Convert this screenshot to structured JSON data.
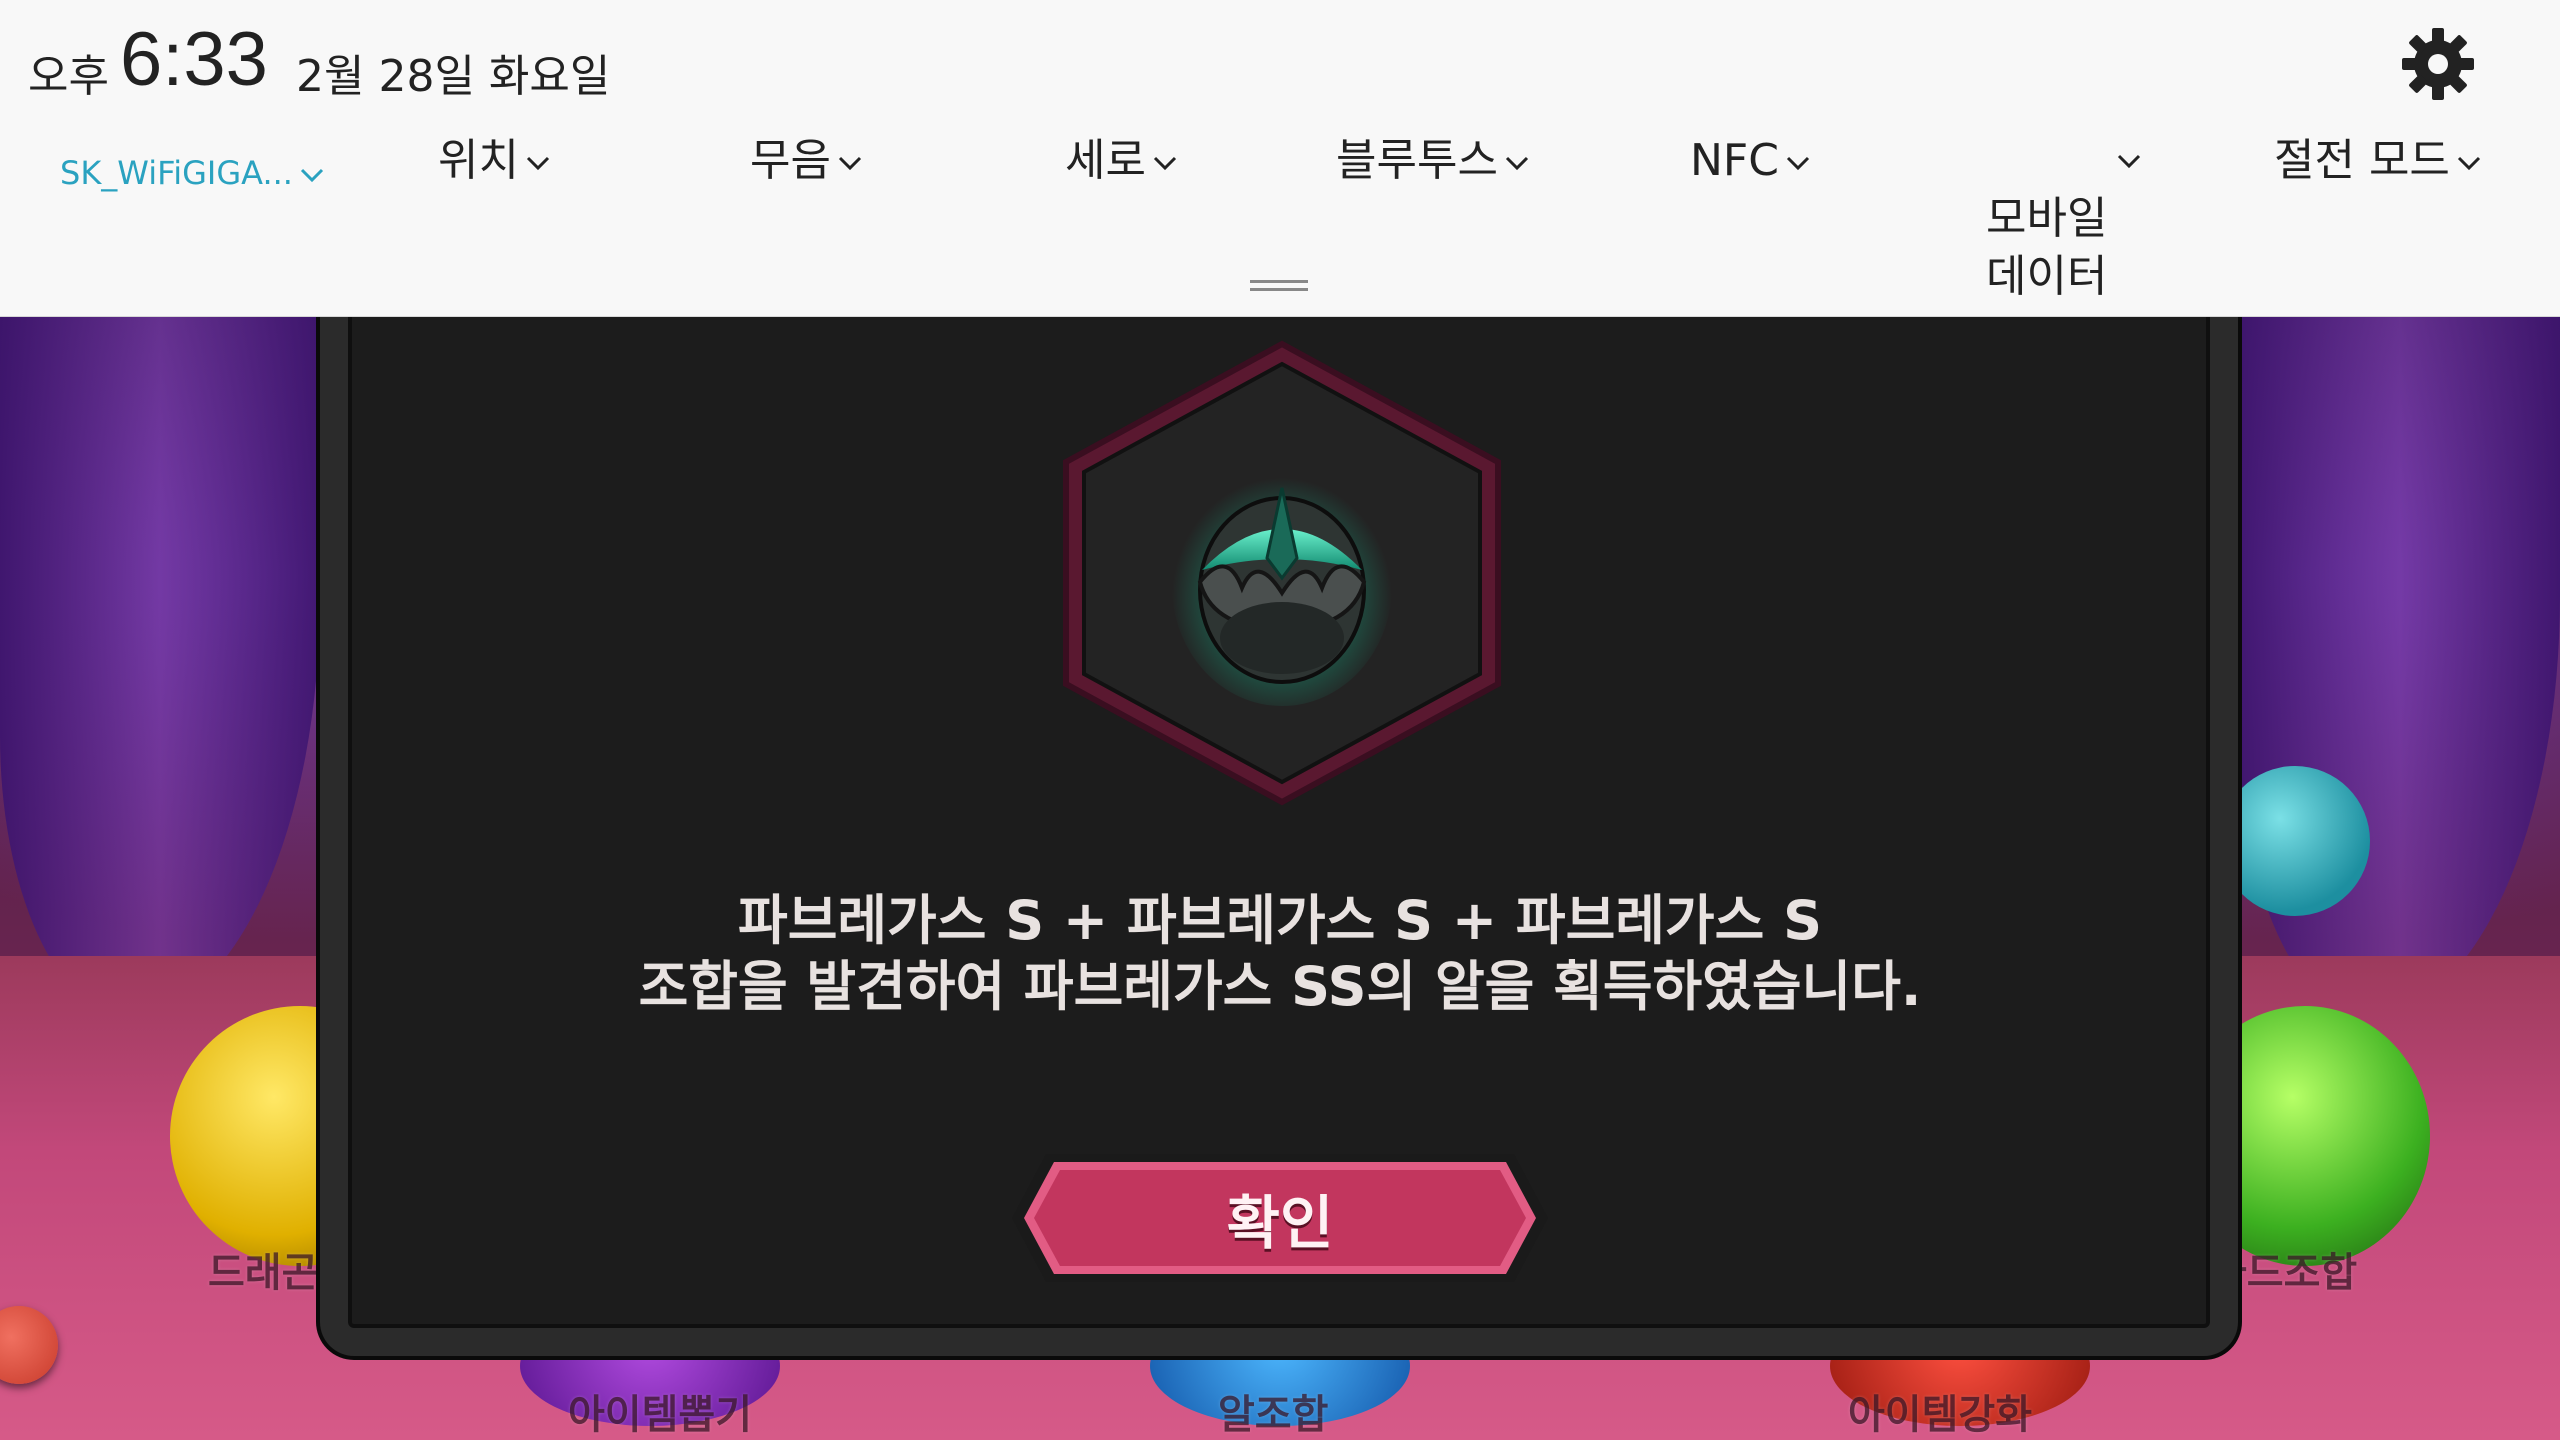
{
  "status_bar": {
    "ampm": "오후",
    "time": "6:33",
    "date": "2월 28일 화요일"
  },
  "quick_settings": [
    {
      "label": "SK_WiFiGIGA...",
      "key": "wifi"
    },
    {
      "label": "위치",
      "key": "location"
    },
    {
      "label": "무음",
      "key": "sound"
    },
    {
      "label": "세로",
      "key": "rotation"
    },
    {
      "label": "블루투스",
      "key": "bluetooth"
    },
    {
      "label": "NFC",
      "key": "nfc"
    },
    {
      "label": "모바일\n데이터",
      "key": "mobile_data"
    },
    {
      "label": "절전 모드",
      "key": "power_saving"
    }
  ],
  "colors": {
    "wifi_accent": "#2aa2c0",
    "confirm_button": "#c2365e",
    "egg_glow": "#3fe0b0"
  },
  "dialog": {
    "message_line1": "파브레가스 S + 파브레가스 S + 파브레가스 S",
    "message_line2": "조합을 발견하여 파브레가스 SS의 알을 획득하였습니다.",
    "confirm_label": "확인",
    "badge_icon": "dragon-egg-icon"
  },
  "background_menu": {
    "labels": [
      "드래곤",
      "아이템뽑기",
      "알조합",
      "아이템강화",
      "카드조합"
    ]
  }
}
